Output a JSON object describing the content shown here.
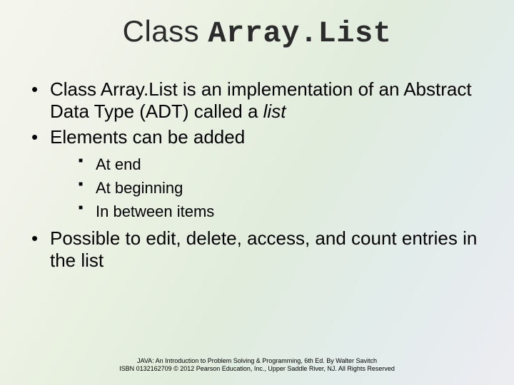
{
  "title": {
    "word1": "Class",
    "word2": "Array.List"
  },
  "bullets": {
    "b1_pre": "Class Array.List is an implementation of an Abstract Data Type (ADT) called a ",
    "b1_em": "list",
    "b2": "Elements can be added",
    "sub": {
      "s1": "At end",
      "s2": "At beginning",
      "s3": "In between items"
    },
    "b3": "Possible to edit, delete, access, and count entries in the list"
  },
  "footer": {
    "line1": "JAVA: An Introduction to Problem Solving & Programming, 6th Ed. By Walter Savitch",
    "line2": "ISBN 0132162709 © 2012 Pearson Education, Inc., Upper Saddle River, NJ. All Rights Reserved"
  }
}
